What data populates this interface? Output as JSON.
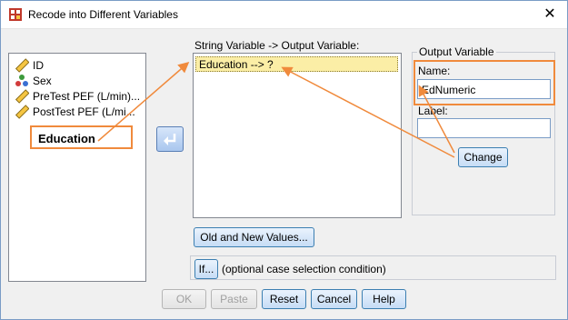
{
  "window": {
    "title": "Recode into Different Variables",
    "close_glyph": "✕"
  },
  "variables": [
    {
      "label": "ID",
      "icon": "ruler-icon"
    },
    {
      "label": "Sex",
      "icon": "nominal-icon"
    },
    {
      "label": "PreTest PEF (L/min)...",
      "icon": "ruler-icon"
    },
    {
      "label": "PostTest PEF (L/mi...",
      "icon": "ruler-icon"
    }
  ],
  "selected_variable": "Education",
  "string_var": {
    "label": "String Variable -> Output Variable:",
    "items": [
      "Education --> ?"
    ]
  },
  "output": {
    "group_title": "Output Variable",
    "name_label": "Name:",
    "name_value": "EdNumeric",
    "label_label": "Label:",
    "label_value": "",
    "change": "Change"
  },
  "buttons": {
    "old_new": "Old and New Values...",
    "if": "If...",
    "if_note": "(optional case selection condition)",
    "ok": "OK",
    "paste": "Paste",
    "reset": "Reset",
    "cancel": "Cancel",
    "help": "Help"
  },
  "colors": {
    "annotation": "#f08a3c",
    "selection": "#fbeea6",
    "accent": "#3c7fb1"
  }
}
